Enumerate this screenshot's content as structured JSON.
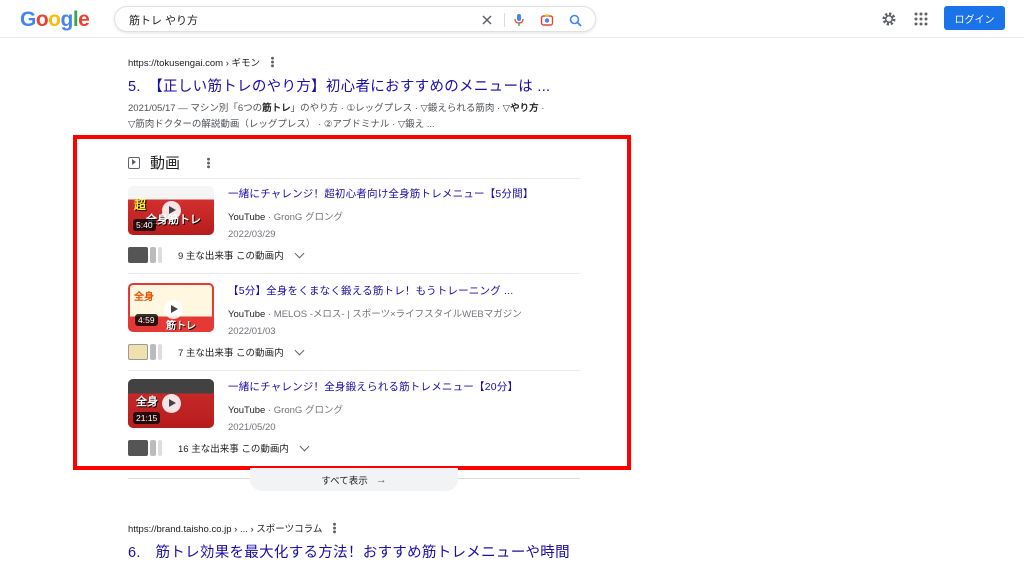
{
  "header": {
    "logo": [
      "G",
      "o",
      "o",
      "g",
      "l",
      "e"
    ],
    "logo_colors": [
      "#4285F4",
      "#EA4335",
      "#FBBC05",
      "#4285F4",
      "#34A853",
      "#EA4335"
    ],
    "query": "筋トレ やり方",
    "login_label": "ログイン"
  },
  "result5": {
    "url": "https://tokusengai.com › ギモン",
    "title": "5.　【正しい筋トレのやり方】初心者におすすめのメニューは ...",
    "snippet_date": "2021/05/17 — マシン別「6つの",
    "snippet_bold": "筋トレ",
    "snippet_rest": "」のやり方 · ①レッグプレス · ▽鍛えられる筋肉 · ▽",
    "snippet_bold2": "やり方",
    "snippet_rest2": " · ▽筋肉ドクターの解説動画（レッグプレス） · ②アブドミナル · ▽鍛え ..."
  },
  "video_panel": {
    "heading": "動画",
    "videos": [
      {
        "title": "一緒にチャレンジ！超初心者向け全身筋トレメニュー【5分間】",
        "source": "YouTube",
        "channel": "GronG グロング",
        "date": "2022/03/29",
        "duration": "5:40",
        "moments": "9 主な出来事 この動画内"
      },
      {
        "title": "【5分】全身をくまなく鍛える筋トレ！もうトレーニング ...",
        "source": "YouTube",
        "channel": "MELOS -メロス- | スポーツ×ライフスタイルWEBマガジン",
        "date": "2022/01/03",
        "duration": "4:59",
        "moments": "7 主な出来事 この動画内"
      },
      {
        "title": "一緒にチャレンジ！全身鍛えられる筋トレメニュー【20分】",
        "source": "YouTube",
        "channel": "GronG グロング",
        "date": "2021/05/20",
        "duration": "21:15",
        "moments": "16 主な出来事 この動画内"
      }
    ],
    "show_all": "すべて表示"
  },
  "result6": {
    "url": "https://brand.taisho.co.jp › ... › スポーツコラム",
    "title": "6.　筋トレ効果を最大化する方法！おすすめ筋トレメニューや時間"
  }
}
